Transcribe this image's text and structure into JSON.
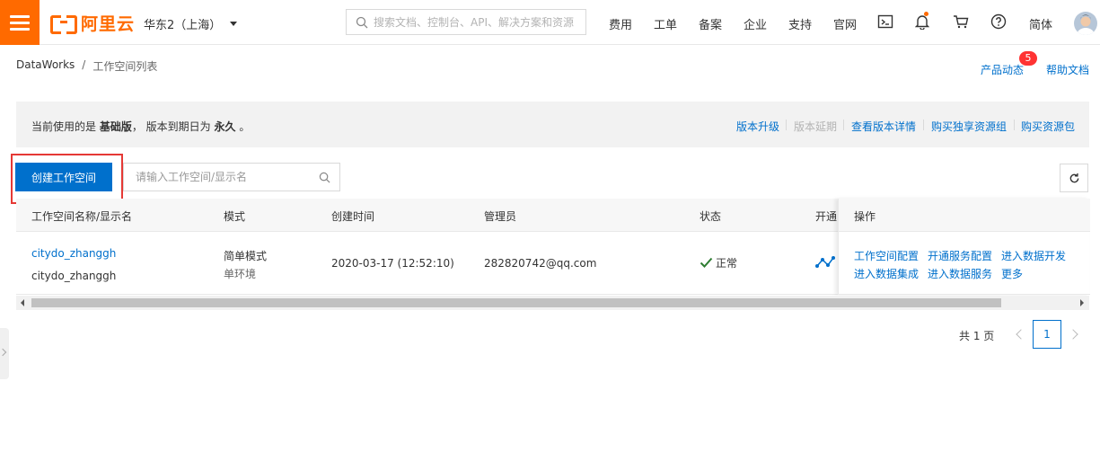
{
  "header": {
    "logo_text": "阿里云",
    "region": "华东2（上海）",
    "search_placeholder": "搜索文档、控制台、API、解决方案和资源",
    "nav": [
      "费用",
      "工单",
      "备案",
      "企业",
      "支持",
      "官网"
    ],
    "language": "简体",
    "icons": [
      "menu-icon",
      "terminal-icon",
      "bell-icon",
      "cart-icon",
      "help-icon",
      "avatar"
    ],
    "accent_color": "#ff6a00"
  },
  "breadcrumb": {
    "root": "DataWorks",
    "separator": "/",
    "current": "工作空间列表"
  },
  "top_links": {
    "product_news": "产品动态",
    "news_badge": "5",
    "help_docs": "帮助文档"
  },
  "banner": {
    "prefix": "当前使用的是",
    "edition": "基础版",
    "middle": "，  版本到期日为",
    "expiry": "永久",
    "suffix": "。",
    "links": {
      "upgrade": "版本升级",
      "extend": "版本延期",
      "details": "查看版本详情",
      "buy_group": "购买独享资源组",
      "buy_pack": "购买资源包"
    }
  },
  "toolbar": {
    "create_label": "创建工作空间",
    "search_placeholder": "请输入工作空间/显示名"
  },
  "table": {
    "columns": {
      "name": "工作空间名称/显示名",
      "mode": "模式",
      "created": "创建时间",
      "admin": "管理员",
      "status": "状态",
      "services": "开通",
      "actions": "操作"
    },
    "rows": [
      {
        "name": "citydo_zhanggh",
        "display_name": "citydo_zhanggh",
        "mode": "简单模式",
        "env": "单环境",
        "created": "2020-03-17 (12:52:10)",
        "admin": "282820742@qq.com",
        "status": "正常",
        "actions": [
          "工作空间配置",
          "开通服务配置",
          "进入数据开发",
          "进入数据集成",
          "进入数据服务",
          "更多"
        ]
      }
    ]
  },
  "pagination": {
    "total_label": "共 1 页",
    "current_page": "1"
  },
  "colors": {
    "primary": "#0070cc",
    "success": "#2e7d32",
    "highlight": "#e53935"
  }
}
